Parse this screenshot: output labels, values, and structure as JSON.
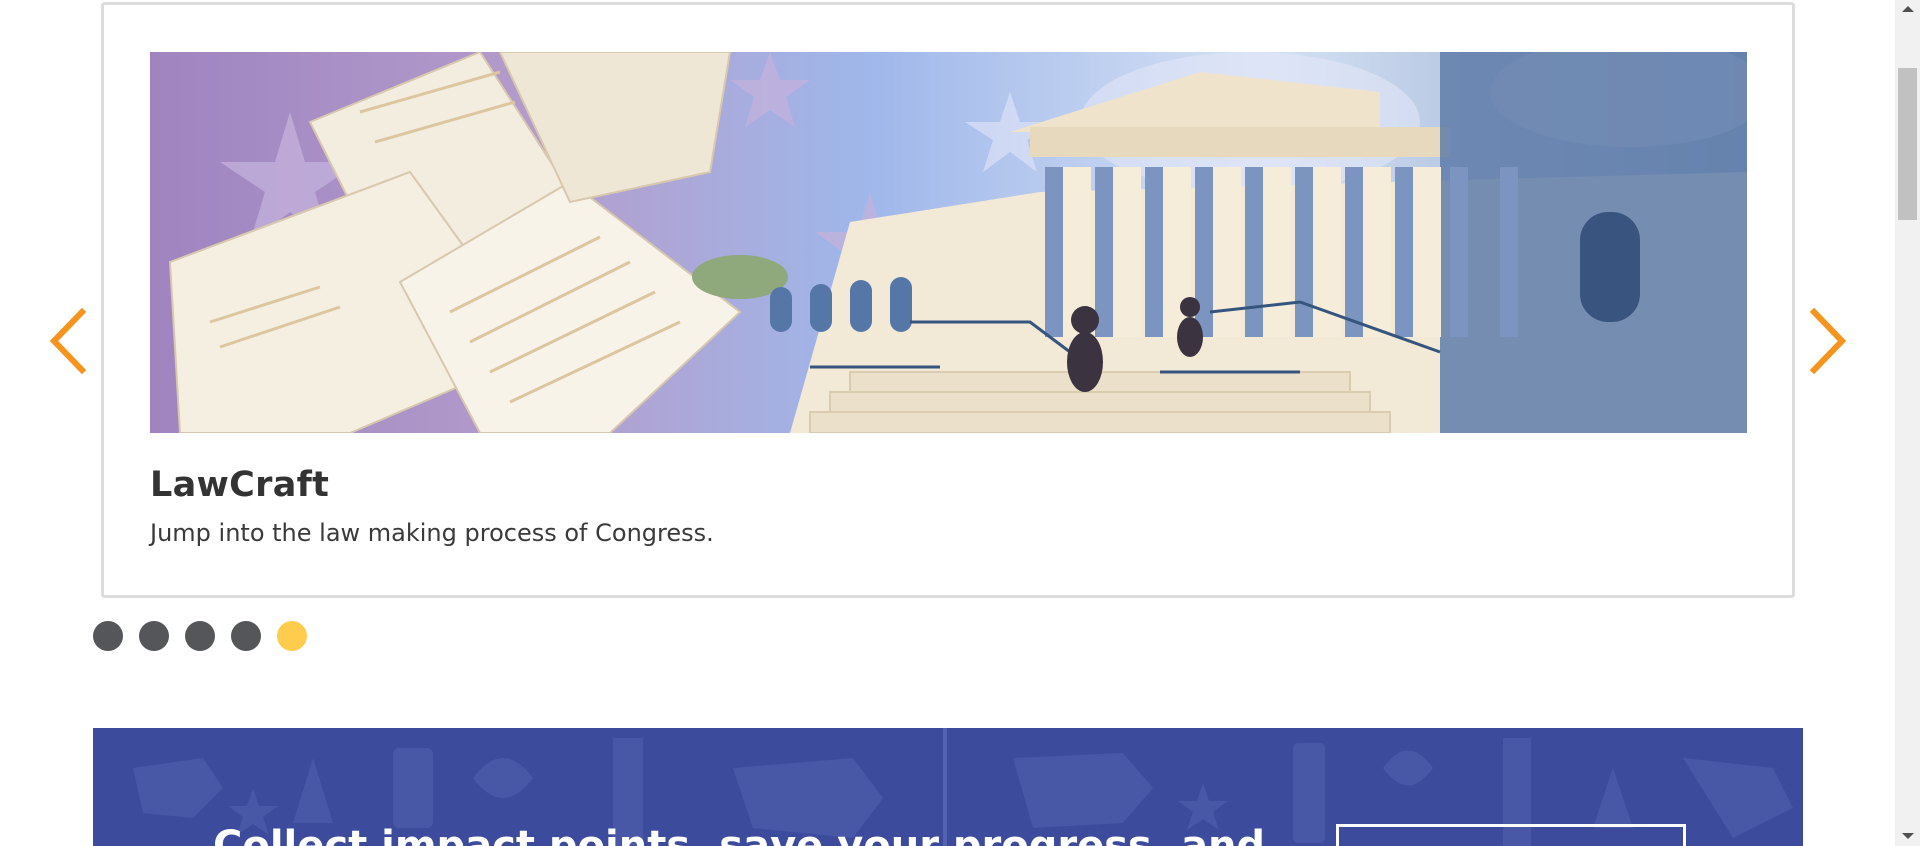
{
  "carousel": {
    "slide": {
      "image_alt": "Illustration of papers flying over a purple sky with stars next to the U.S. Capitol steps",
      "title": "LawCraft",
      "description": "Jump into the law making process of Congress."
    },
    "prev_icon": "chevron-left-icon",
    "next_icon": "chevron-right-icon",
    "dots_total": 5,
    "active_dot": 5
  },
  "banner": {
    "text": "Collect impact points, save your progress, and"
  },
  "colors": {
    "arrow": "#f7941d",
    "dot": "#55565a",
    "dot_active": "#ffcc4e",
    "banner": "#3c4b9c",
    "title": "#333333"
  }
}
